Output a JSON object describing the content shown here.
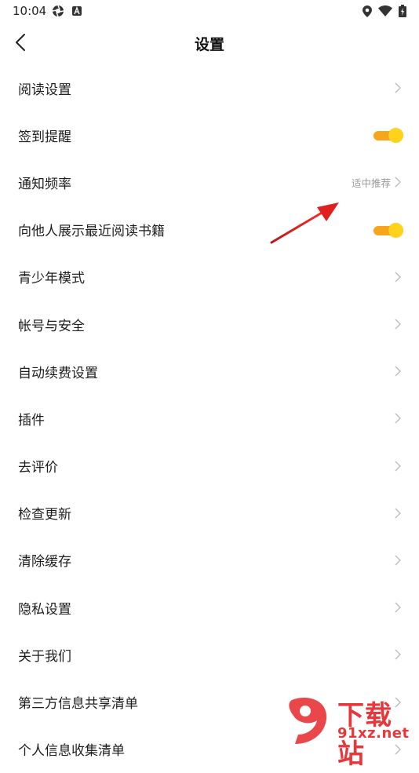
{
  "status_bar": {
    "time": "10:04"
  },
  "header": {
    "title": "设置"
  },
  "settings": [
    {
      "label": "阅读设置",
      "type": "chevron"
    },
    {
      "label": "签到提醒",
      "type": "toggle",
      "on": true
    },
    {
      "label": "通知频率",
      "type": "chevron",
      "value": "适中推荐"
    },
    {
      "label": "向他人展示最近阅读书籍",
      "type": "toggle",
      "on": true
    },
    {
      "label": "青少年模式",
      "type": "chevron"
    },
    {
      "label": "帐号与安全",
      "type": "chevron"
    },
    {
      "label": "自动续费设置",
      "type": "chevron"
    },
    {
      "label": "插件",
      "type": "chevron"
    },
    {
      "label": "去评价",
      "type": "chevron"
    },
    {
      "label": "检查更新",
      "type": "chevron"
    },
    {
      "label": "清除缓存",
      "type": "chevron"
    },
    {
      "label": "隐私设置",
      "type": "chevron"
    },
    {
      "label": "关于我们",
      "type": "chevron"
    },
    {
      "label": "第三方信息共享清单",
      "type": "chevron"
    },
    {
      "label": "个人信息收集清单",
      "type": "chevron"
    }
  ],
  "watermark": {
    "top_text": "下载站",
    "bottom_text": "91xz.net"
  },
  "colors": {
    "toggle_track": "#f6a51c",
    "toggle_knob": "#ffd31a",
    "arrow": "#e02020",
    "watermark": "#e8373b"
  }
}
